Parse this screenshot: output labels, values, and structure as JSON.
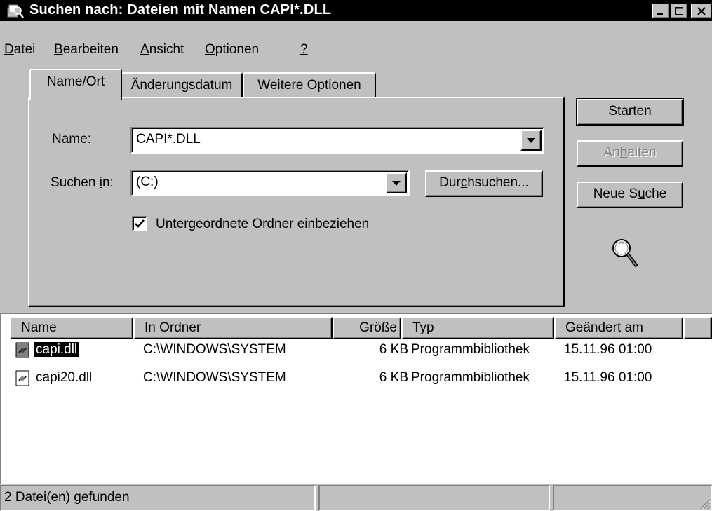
{
  "window": {
    "title": "Suchen nach: Dateien mit Namen CAPI*.DLL",
    "icon": "find-icon",
    "controls": [
      "minimize-icon",
      "maximize-icon",
      "close-icon"
    ]
  },
  "menu": {
    "items": [
      {
        "u": "D",
        "rest": "atei"
      },
      {
        "u": "B",
        "rest": "earbeiten"
      },
      {
        "u": "A",
        "rest": "nsicht"
      },
      {
        "u": "O",
        "rest": "ptionen"
      },
      {
        "u": "?",
        "rest": ""
      }
    ]
  },
  "tabs": [
    {
      "label": "Name/Ort",
      "active": true
    },
    {
      "label": "Änderungsdatum",
      "active": false
    },
    {
      "label": "Weitere Optionen",
      "active": false
    }
  ],
  "form": {
    "name_label_u": "N",
    "name_label_rest": "ame:",
    "name_value": "CAPI*.DLL",
    "lookin_label_pre": "Suchen ",
    "lookin_label_u": "i",
    "lookin_label_post": "n:",
    "lookin_value": "(C:)",
    "browse_pre": "Dur",
    "browse_u": "c",
    "browse_post": "hsuchen...",
    "subfolders_checked": true,
    "subfolders_pre": "Untergeordnete ",
    "subfolders_u": "O",
    "subfolders_post": "rdner einbeziehen"
  },
  "buttons": {
    "start_u": "S",
    "start_rest": "tarten",
    "stop_pre": "An",
    "stop_u": "h",
    "stop_post": "alten",
    "new_pre": "Neue S",
    "new_u": "u",
    "new_post": "che"
  },
  "results": {
    "columns": [
      "Name",
      "In Ordner",
      "Größe",
      "Typ",
      "Geändert am"
    ],
    "rows": [
      {
        "name": "capi.dll",
        "folder": "C:\\WINDOWS\\SYSTEM",
        "size": "6 KB",
        "type": "Programmbibliothek",
        "modified": "15.11.96 01:00",
        "selected": true
      },
      {
        "name": "capi20.dll",
        "folder": "C:\\WINDOWS\\SYSTEM",
        "size": "6 KB",
        "type": "Programmbibliothek",
        "modified": "15.11.96 01:00",
        "selected": false
      }
    ]
  },
  "status": {
    "text": "2 Datei(en) gefunden"
  },
  "colors": {
    "face": "#c0c0c0",
    "titlebar": "#000000",
    "selection": "#000000"
  }
}
